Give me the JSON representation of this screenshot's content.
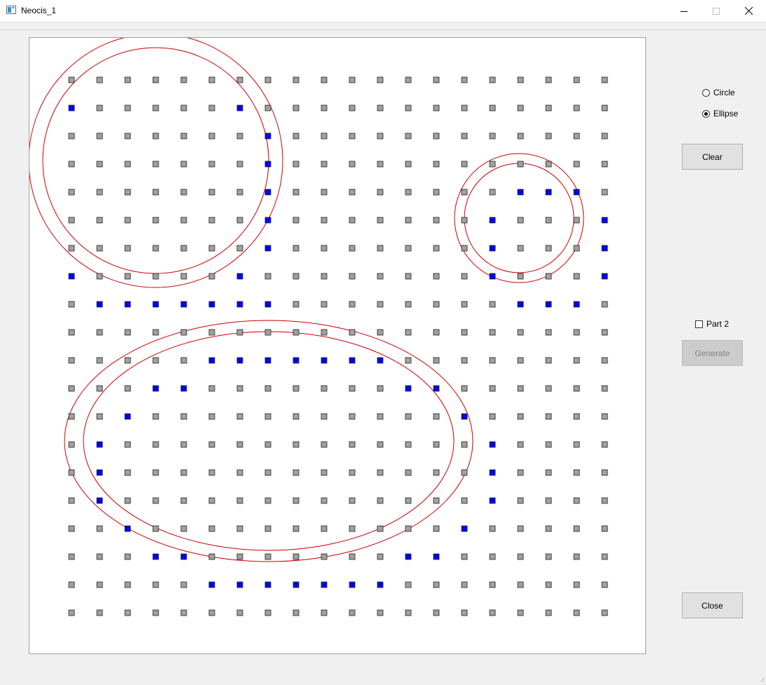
{
  "window": {
    "title": "Neocis_1"
  },
  "controls": {
    "circle_label": "Circle",
    "ellipse_label": "Ellipse",
    "selected_shape": "ellipse",
    "clear_label": "Clear",
    "part2_label": "Part 2",
    "part2_checked": false,
    "generate_label": "Generate",
    "generate_enabled": false,
    "close_label": "Close"
  },
  "grid": {
    "columns": 20,
    "rows": 20,
    "default_color": "#a0a0a0",
    "selected_color": "#0000ff",
    "selected_cells": [
      [
        1,
        0
      ],
      [
        1,
        6
      ],
      [
        2,
        7
      ],
      [
        3,
        7
      ],
      [
        4,
        7
      ],
      [
        5,
        7
      ],
      [
        6,
        7
      ],
      [
        7,
        0
      ],
      [
        7,
        6
      ],
      [
        8,
        1
      ],
      [
        8,
        2
      ],
      [
        8,
        3
      ],
      [
        8,
        4
      ],
      [
        8,
        5
      ],
      [
        8,
        6
      ],
      [
        8,
        7
      ],
      [
        10,
        5
      ],
      [
        10,
        6
      ],
      [
        10,
        7
      ],
      [
        10,
        8
      ],
      [
        10,
        9
      ],
      [
        10,
        10
      ],
      [
        10,
        11
      ],
      [
        11,
        3
      ],
      [
        11,
        4
      ],
      [
        11,
        12
      ],
      [
        11,
        13
      ],
      [
        12,
        2
      ],
      [
        12,
        14
      ],
      [
        13,
        1
      ],
      [
        13,
        15
      ],
      [
        14,
        1
      ],
      [
        14,
        15
      ],
      [
        15,
        1
      ],
      [
        15,
        15
      ],
      [
        16,
        2
      ],
      [
        16,
        14
      ],
      [
        17,
        3
      ],
      [
        17,
        4
      ],
      [
        17,
        12
      ],
      [
        17,
        13
      ],
      [
        18,
        5
      ],
      [
        18,
        6
      ],
      [
        18,
        7
      ],
      [
        18,
        8
      ],
      [
        18,
        9
      ],
      [
        18,
        10
      ],
      [
        18,
        11
      ],
      [
        4,
        16
      ],
      [
        4,
        17
      ],
      [
        4,
        18
      ],
      [
        5,
        15
      ],
      [
        5,
        19
      ],
      [
        6,
        15
      ],
      [
        6,
        19
      ],
      [
        7,
        15
      ],
      [
        7,
        19
      ],
      [
        8,
        16
      ],
      [
        8,
        17
      ],
      [
        8,
        18
      ]
    ]
  },
  "shapes": {
    "stroke_color": "#cc0000"
  },
  "colors": {
    "window_bg": "#f0f0f0",
    "canvas_bg": "#ffffff",
    "button_bg": "#e1e1e1"
  }
}
